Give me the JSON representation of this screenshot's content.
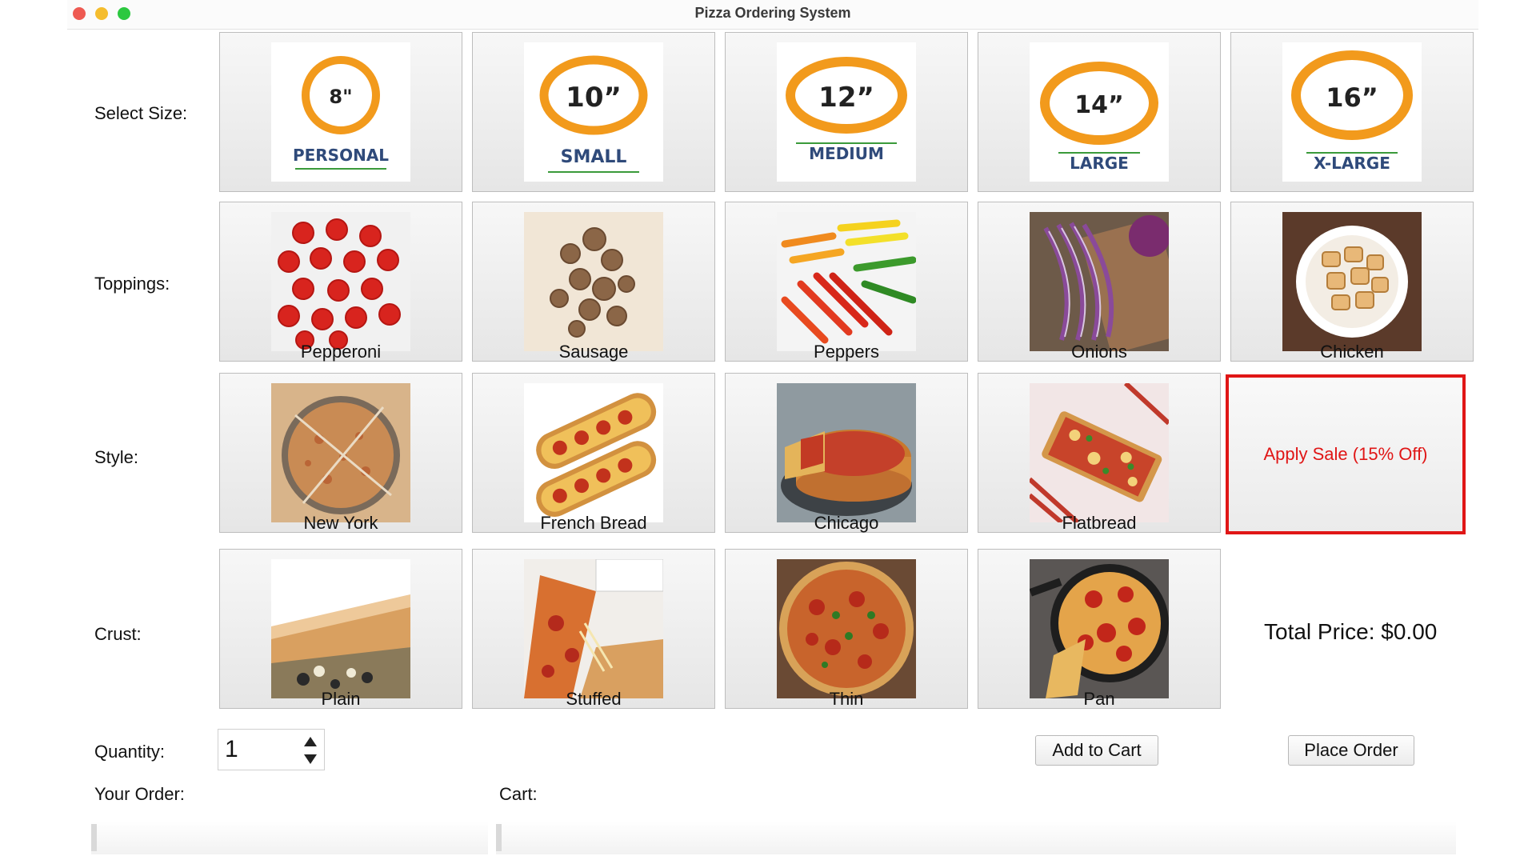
{
  "window": {
    "title": "Pizza Ordering System"
  },
  "labels": {
    "size": "Select Size:",
    "toppings": "Toppings:",
    "style": "Style:",
    "crust": "Crust:",
    "quantity": "Quantity:",
    "your_order": "Your Order:",
    "cart": "Cart:"
  },
  "sizes": [
    {
      "inches": "8\"",
      "name": "PERSONAL"
    },
    {
      "inches": "10”",
      "name": "SMALL"
    },
    {
      "inches": "12”",
      "name": "MEDIUM"
    },
    {
      "inches": "14”",
      "name": "LARGE"
    },
    {
      "inches": "16”",
      "name": "X-LARGE"
    }
  ],
  "toppings": [
    "Pepperoni",
    "Sausage",
    "Peppers",
    "Onions",
    "Chicken"
  ],
  "styles": [
    "New York",
    "French Bread",
    "Chicago",
    "Flatbread"
  ],
  "crusts": [
    "Plain",
    "Stuffed",
    "Thin",
    "Pan"
  ],
  "sale_button": "Apply Sale (15% Off)",
  "total_price": "Total Price: $0.00",
  "quantity": {
    "value": "1"
  },
  "buttons": {
    "add_to_cart": "Add to Cart",
    "place_order": "Place Order"
  },
  "colors": {
    "size_ring": "#f29a1c",
    "size_text": "#2f4a7a",
    "size_underline": "#3a9a3a",
    "sale": "#e01616"
  }
}
